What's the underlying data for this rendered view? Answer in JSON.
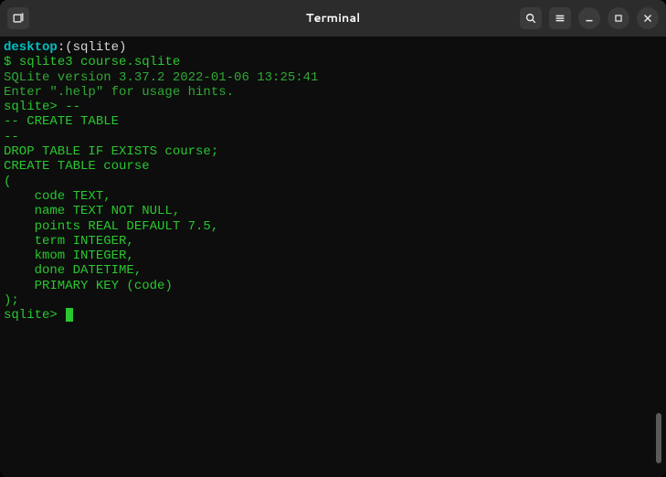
{
  "window": {
    "title": "Terminal"
  },
  "icons": {
    "newtab": "new-tab-icon",
    "search": "search-icon",
    "menu": "menu-icon",
    "minimize": "minimize-icon",
    "maximize": "maximize-icon",
    "close": "close-icon"
  },
  "prompt": {
    "host": "desktop",
    "path": "(sqlite)",
    "dollar": "$",
    "command": "sqlite3 course.sqlite"
  },
  "output": {
    "version": "SQLite version 3.37.2 2022-01-06 13:25:41",
    "hint": "Enter \".help\" for usage hints."
  },
  "sql": {
    "p1": "sqlite> ",
    "l1": "--",
    "l2": "-- CREATE TABLE",
    "l3": "--",
    "l4": "DROP TABLE IF EXISTS course;",
    "l5": "CREATE TABLE course",
    "l6": "(",
    "l7": "    code TEXT,",
    "l8": "    name TEXT NOT NULL,",
    "l9": "    points REAL DEFAULT 7.5,",
    "l10": "    term INTEGER,",
    "l11": "    kmom INTEGER,",
    "l12": "    done DATETIME,",
    "l13": "",
    "l14": "    PRIMARY KEY (code)",
    "l15": ");",
    "p2": "sqlite> "
  }
}
